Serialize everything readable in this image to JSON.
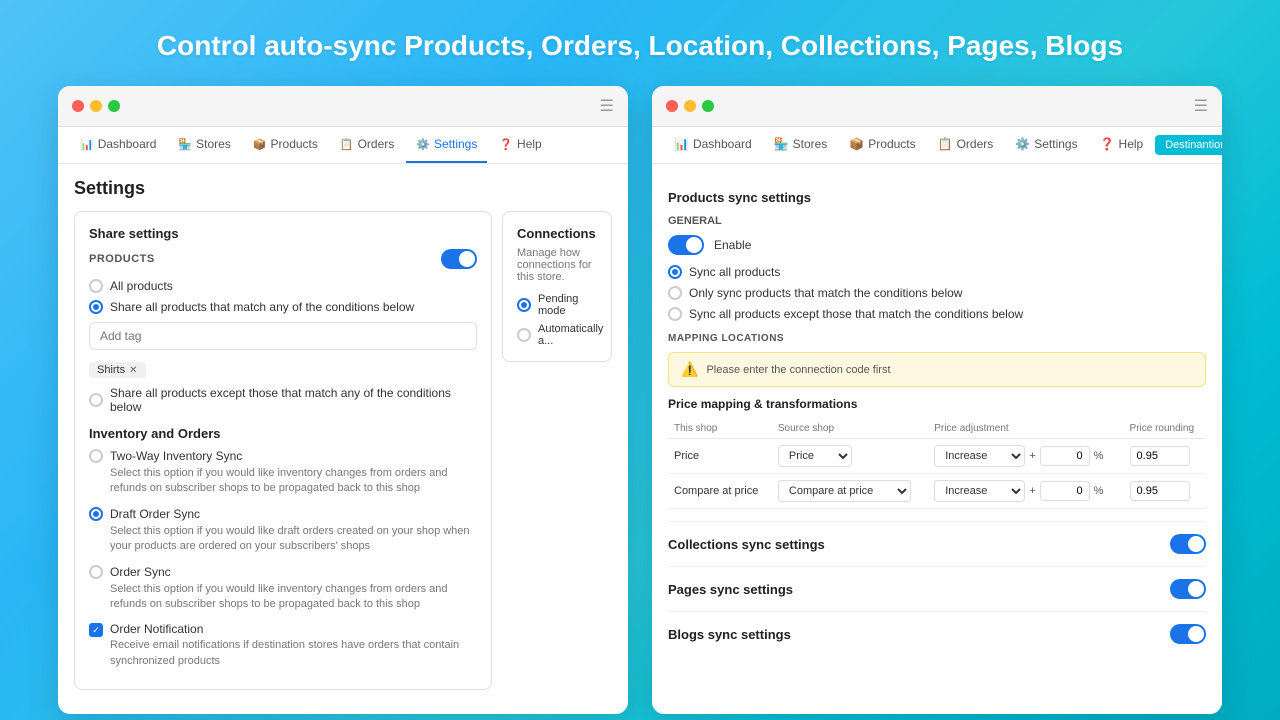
{
  "headline": "Control auto-sync Products, Orders, Location, Collections, Pages, Blogs",
  "left_panel": {
    "nav": {
      "items": [
        {
          "label": "Dashboard",
          "icon": "📊",
          "active": false
        },
        {
          "label": "Stores",
          "icon": "🏪",
          "active": false
        },
        {
          "label": "Products",
          "icon": "📦",
          "active": false
        },
        {
          "label": "Orders",
          "icon": "📋",
          "active": false
        },
        {
          "label": "Settings",
          "icon": "⚙️",
          "active": true
        },
        {
          "label": "Help",
          "icon": "❓",
          "active": false
        }
      ]
    },
    "settings_title": "Settings",
    "share_settings": {
      "title": "Share settings",
      "products_label": "PRODUCTS",
      "toggle_on": true,
      "radio_options": [
        {
          "label": "All products",
          "selected": false
        },
        {
          "label": "Share all products that match any of the conditions below",
          "selected": true
        },
        {
          "label": "Share all products except those that match any of the conditions below",
          "selected": false
        }
      ],
      "tag_placeholder": "Add tag",
      "tags": [
        "Shirts"
      ]
    },
    "inventory_section": {
      "title": "Inventory and Orders",
      "items": [
        {
          "label": "Two-Way Inventory Sync",
          "selected": false,
          "desc": "Select this option if you would like inventory changes from orders and refunds on subscriber shops to be propagated back to this shop"
        },
        {
          "label": "Draft Order Sync",
          "selected": true,
          "desc": "Select this option if you would like draft orders created on your shop when your products are ordered on your subscribers' shops"
        },
        {
          "label": "Order Sync",
          "selected": false,
          "desc": "Select this option if you would like inventory changes from orders and refunds on subscriber shops to be propagated back to this shop"
        }
      ]
    },
    "notifications": {
      "label": "Order Notification",
      "checked": true,
      "desc": "Receive email notifications if destination stores have orders that contain synchronized products"
    },
    "connections_title": "Connections",
    "connections_desc": "Manage how connections for this store."
  },
  "right_panel": {
    "nav": {
      "items": [
        {
          "label": "Dashboard",
          "icon": "📊",
          "active": false
        },
        {
          "label": "Stores",
          "icon": "🏪",
          "active": false
        },
        {
          "label": "Products",
          "icon": "📦",
          "active": false
        },
        {
          "label": "Orders",
          "icon": "📋",
          "active": false
        },
        {
          "label": "Settings",
          "icon": "⚙️",
          "active": false
        },
        {
          "label": "Help",
          "icon": "❓",
          "active": false
        }
      ],
      "destination_btn": "Destinantion"
    },
    "products_sync": {
      "title": "Products sync settings",
      "general_label": "General",
      "enable_label": "Enable",
      "toggle_on": true,
      "radio_options": [
        {
          "label": "Sync all products",
          "selected": true
        },
        {
          "label": "Only sync products that match the conditions below",
          "selected": false
        },
        {
          "label": "Sync all products except those that match the conditions below",
          "selected": false
        }
      ],
      "mapping_label": "MAPPING LOCATIONS",
      "warning": "Please enter the connection code first",
      "price_mapping_title": "Price mapping & transformations",
      "price_table": {
        "headers": [
          "This shop",
          "Source shop",
          "Price adjustment",
          "Price rounding"
        ],
        "rows": [
          {
            "this_shop": "Price",
            "source_shop": "Price",
            "adj_type": "Increase",
            "adj_value": "0",
            "adj_pct": "%",
            "rounding": "0.95"
          },
          {
            "this_shop": "Compare at price",
            "source_shop": "Compare at price",
            "adj_type": "Increase",
            "adj_value": "0",
            "adj_pct": "%",
            "rounding": "0.95"
          }
        ]
      }
    },
    "collections_sync": {
      "title": "Collections sync settings",
      "toggle_on": true
    },
    "pages_sync": {
      "title": "Pages sync settings",
      "toggle_on": true
    },
    "blogs_sync": {
      "title": "Blogs sync settings",
      "toggle_on": true
    }
  }
}
